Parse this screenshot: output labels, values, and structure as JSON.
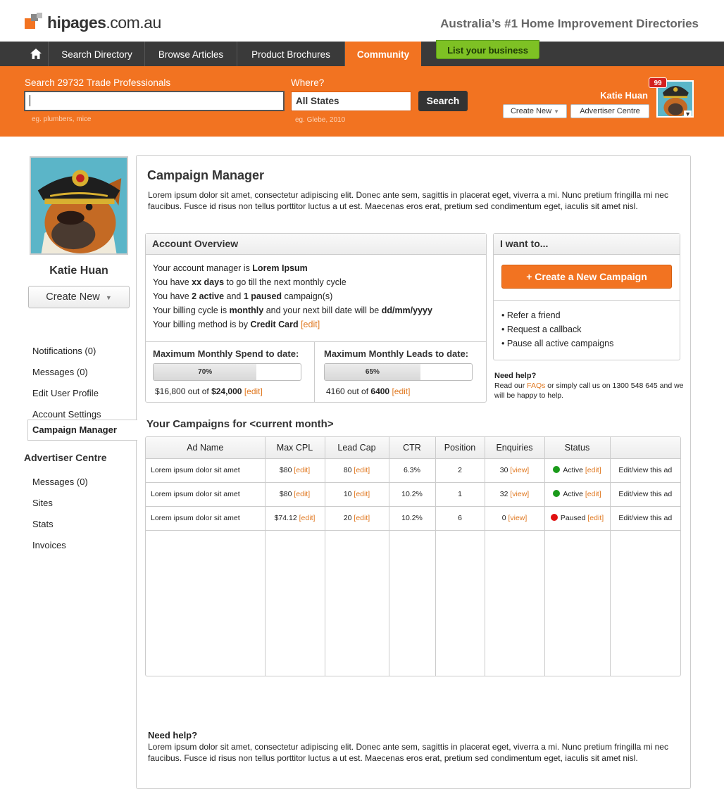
{
  "header": {
    "logo_text_bold": "hipages",
    "logo_text_rest": ".com.au",
    "tagline": "Australia’s #1 Home Improvement Directories"
  },
  "nav": {
    "home_icon": "home-icon",
    "items": [
      {
        "label": "Search Directory"
      },
      {
        "label": "Browse Articles"
      },
      {
        "label": "Product Brochures"
      },
      {
        "label": "Community",
        "active": true
      }
    ],
    "list_business": "List your business"
  },
  "search": {
    "label": "Search 29732 Trade Professionals",
    "value": "",
    "hint": "eg. plumbers, mice",
    "where_label": "Where?",
    "where_value": "All States",
    "where_hint": "eg. Glebe, 2010",
    "button": "Search"
  },
  "user": {
    "name": "Katie Huan",
    "badge": "99",
    "create_new": "Create New",
    "advertiser_centre": "Advertiser Centre"
  },
  "sidebar": {
    "name": "Katie Huan",
    "create_new": "Create New",
    "links": [
      "Notifications (0)",
      "Messages (0)",
      "Edit User Profile",
      "Account Settings"
    ],
    "advertiser_heading": "Advertiser Centre",
    "adv_links": [
      "Messages (0)",
      "Sites",
      "Stats",
      "Invoices"
    ],
    "active": "Campaign Manager"
  },
  "main": {
    "title": "Campaign Manager",
    "intro": "Lorem ipsum dolor sit amet, consectetur adipiscing elit. Donec ante sem, sagittis in placerat eget, viverra a mi. Nunc pretium fringilla mi nec faucibus. Fusce id risus non tellus porttitor luctus a ut est. Maecenas eros erat, pretium sed condimentum eget, iaculis sit amet nisl.",
    "overview": {
      "title": "Account Overview",
      "l1a": "Your account manager is ",
      "l1b": "Lorem Ipsum",
      "l2a": "You have ",
      "l2b": "xx days",
      "l2c": " to go till the next monthly cycle",
      "l3a": "You have ",
      "l3b": "2 active",
      "l3c": " and ",
      "l3d": "1 paused",
      "l3e": " campaign(s)",
      "l4a": "Your billing cycle is ",
      "l4b": "monthly",
      "l4c": " and your next bill date will be ",
      "l4d": "dd/mm/yyyy",
      "l5a": "Your billing method is by ",
      "l5b": "Credit Card",
      "l5c": "[edit]",
      "spend_label": "Maximum Monthly Spend to date:",
      "spend_pct": "70%",
      "spend_fill": 0.7,
      "spend_a": "$16,800 out of ",
      "spend_b": "$24,000",
      "spend_edit": "[edit]",
      "leads_label": "Maximum Monthly Leads to date:",
      "leads_pct": "65%",
      "leads_fill": 0.65,
      "leads_a": "4160 out of ",
      "leads_b": "6400",
      "leads_edit": "[edit]"
    },
    "want": {
      "title": "I want to...",
      "button": "+ Create a New Campaign",
      "items": [
        "• Refer a friend",
        "• Request a callback",
        "• Pause all active campaigns"
      ]
    },
    "help_small": {
      "title": "Need help?",
      "a": "Read our ",
      "faqs": "FAQs",
      "b": " or simply call us on 1300 548 645 and we will be happy to help."
    },
    "campaigns_title": "Your Campaigns for <current month>",
    "table": {
      "headers": [
        "Ad Name",
        "Max CPL",
        "Lead Cap",
        "CTR",
        "Position",
        "Enquiries",
        "Status",
        ""
      ],
      "rows": [
        {
          "name": "Lorem ipsum dolor sit amet",
          "cpl": "$80",
          "cap": "80",
          "ctr": "6.3%",
          "pos": "2",
          "enq": "30",
          "status": "Active",
          "status_color": "#1a9a1a",
          "action": "Edit/view this ad"
        },
        {
          "name": "Lorem ipsum dolor sit amet",
          "cpl": "$80",
          "cap": "10",
          "ctr": "10.2%",
          "pos": "1",
          "enq": "32",
          "status": "Active",
          "status_color": "#1a9a1a",
          "action": "Edit/view this ad"
        },
        {
          "name": "Lorem ipsum dolor sit amet",
          "cpl": "$74.12",
          "cap": "20",
          "ctr": "10.2%",
          "pos": "6",
          "enq": "0",
          "status": "Paused",
          "status_color": "#e01010",
          "action": "Edit/view this ad"
        }
      ],
      "edit": "[edit]",
      "view": "[view]"
    },
    "help_big": {
      "title": "Need help?",
      "text": "Lorem ipsum dolor sit amet, consectetur adipiscing elit. Donec ante sem, sagittis in placerat eget, viverra a mi. Nunc pretium fringilla mi nec faucibus. Fusce id risus non tellus porttitor luctus a ut est. Maecenas eros erat, pretium sed condimentum eget, iaculis sit amet nisl."
    }
  },
  "colors": {
    "brand_orange": "#f27321",
    "nav_dark": "#3a3a3a",
    "link_orange": "#e07820",
    "green": "#7ec124"
  }
}
